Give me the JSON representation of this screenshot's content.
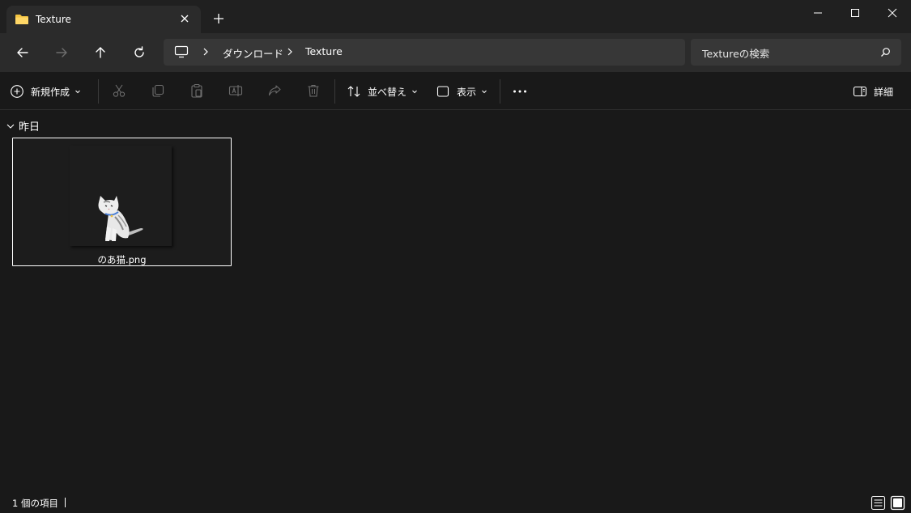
{
  "tab": {
    "title": "Texture"
  },
  "address": {
    "segments": [
      "ダウンロード",
      "Texture"
    ]
  },
  "search": {
    "placeholder": "Textureの検索"
  },
  "toolbar": {
    "new_label": "新規作成",
    "sort_label": "並べ替え",
    "view_label": "表示",
    "details_label": "詳細"
  },
  "group": {
    "label": "昨日"
  },
  "files": [
    {
      "name": "のあ猫.png"
    }
  ],
  "status": {
    "item_count": "1 個の項目"
  },
  "icons": {
    "tab": "folder-icon",
    "close": "close-icon",
    "new_tab": "plus-icon",
    "back": "arrow-left-icon",
    "forward": "arrow-right-icon",
    "up": "arrow-up-icon",
    "refresh": "refresh-icon",
    "pc": "monitor-icon",
    "search": "search-icon",
    "cut": "scissors-icon",
    "copy": "copy-icon",
    "paste": "clipboard-icon",
    "rename": "rename-icon",
    "share": "share-icon",
    "delete": "trash-icon",
    "more": "ellipsis-icon",
    "details": "details-pane-icon"
  },
  "colors": {
    "folder": "#f4c542",
    "background": "#191919",
    "chrome": "#202020",
    "nav": "#2b2b2b"
  }
}
